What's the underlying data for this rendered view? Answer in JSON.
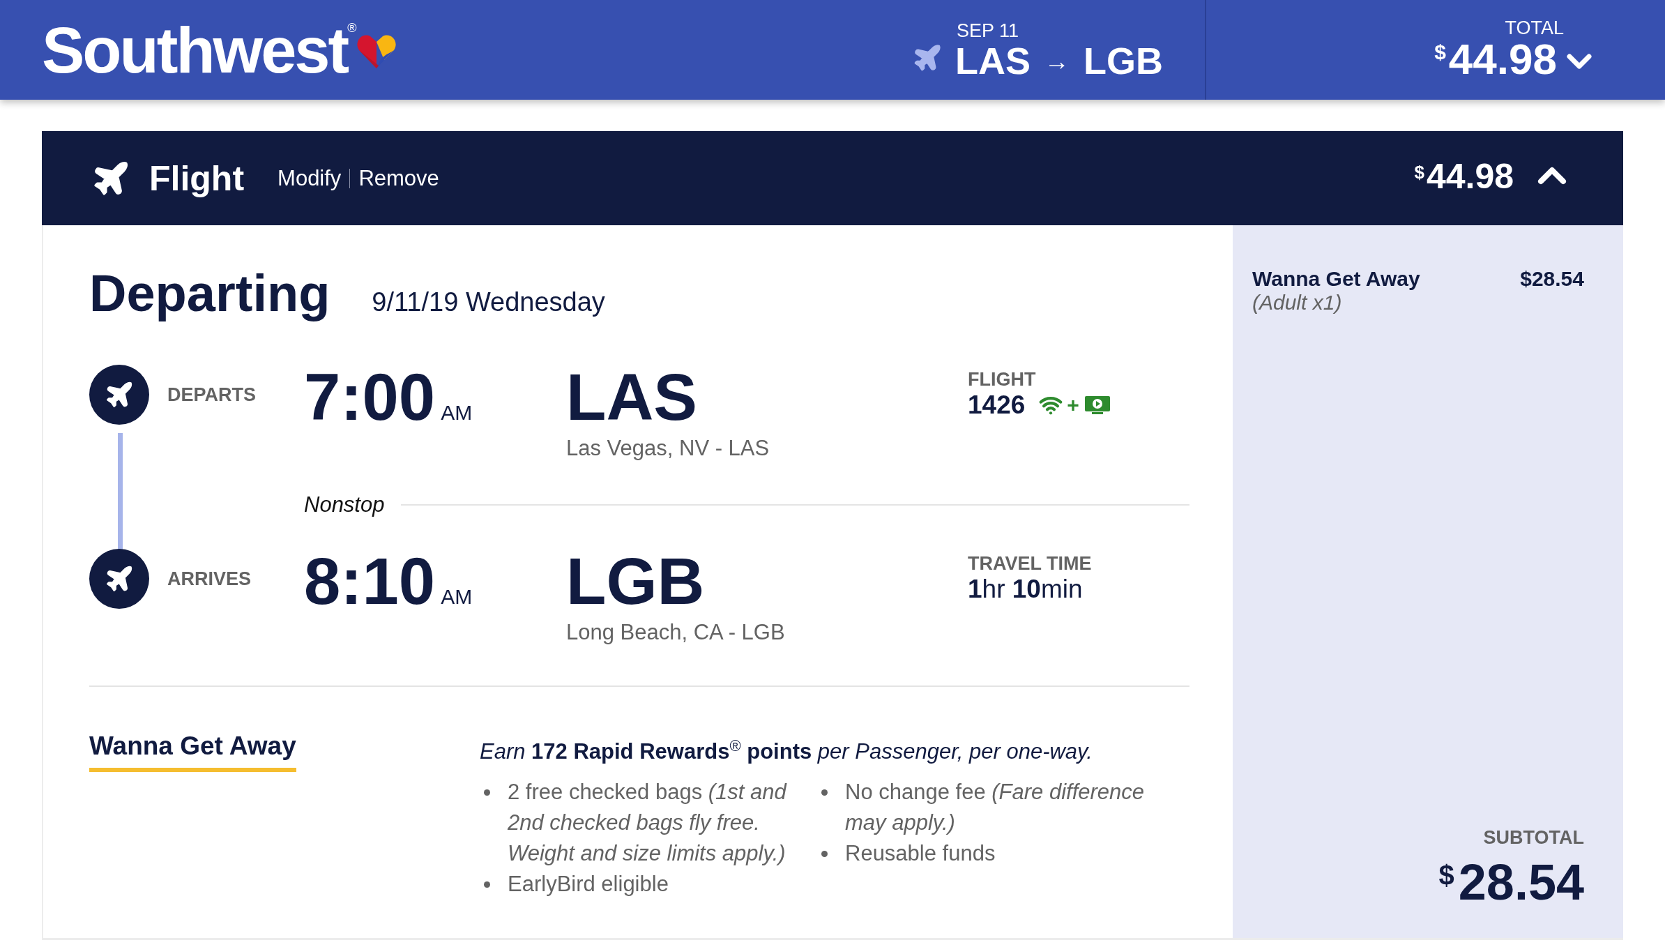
{
  "header": {
    "logo": "Southwest",
    "logo_mark": "®",
    "date": "SEP 11",
    "origin": "LAS",
    "arrow": "→",
    "destination": "LGB",
    "total_label": "TOTAL",
    "currency": "$",
    "total": "44.98"
  },
  "flight_bar": {
    "title": "Flight",
    "links": [
      "Modify",
      "Remove"
    ],
    "currency": "$",
    "price": "44.98"
  },
  "departing": {
    "title": "Departing",
    "date": "9/11/19 Wednesday"
  },
  "segments": [
    {
      "kind": "flight",
      "label": "DEPARTS",
      "time": "7:00",
      "meridiem": "AM",
      "code": "LAS",
      "city": "Las Vegas, NV - LAS",
      "info_label": "FLIGHT",
      "info_value": "1426",
      "amenity_separator": "+"
    },
    {
      "kind": "travel_time",
      "label": "ARRIVES",
      "time": "8:10",
      "meridiem": "AM",
      "code": "LGB",
      "city": "Long Beach, CA - LGB",
      "info_label": "TRAVEL TIME",
      "info_value": "**1**hr **10**min"
    }
  ],
  "nonstop": "Nonstop",
  "fare": {
    "name": "Wanna Get Away",
    "rewards": "Earn **172 Rapid Rewards**$^{®}$ **points** per Passenger, per one-way.",
    "bullet_columns": [
      [
        "2 free checked bags *(1st and 2nd checked bags fly free. Weight and size limits apply.)*",
        "EarlyBird eligible"
      ],
      [
        "No change fee *(Fare difference may apply.)*",
        "Reusable funds"
      ]
    ]
  },
  "summary": {
    "fare_name": "Wanna Get Away",
    "passengers": "(Adult x1)",
    "price": "$28.54",
    "subtotal_label": "SUBTOTAL",
    "currency": "$",
    "subtotal": "28.54"
  }
}
